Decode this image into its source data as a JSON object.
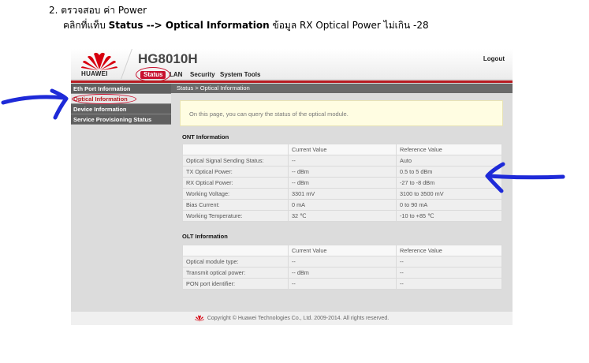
{
  "document": {
    "heading": "2. ตรวจสอบ ค่า Power",
    "instruction": {
      "prefix": "คลิกที่แท็บ ",
      "bold": "Status --> Optical Information",
      "suffix": " ข้อมูล RX Optical Power ไม่เกิน -28"
    }
  },
  "router": {
    "brand": "HUAWEI",
    "model": "HG8010H",
    "logout_label": "Logout",
    "tabs": [
      {
        "label": "Status",
        "active": true
      },
      {
        "label": "LAN",
        "active": false
      },
      {
        "label": "Security",
        "active": false
      },
      {
        "label": "System Tools",
        "active": false
      }
    ],
    "sidebar": [
      {
        "label": "Eth Port Information",
        "sub": false
      },
      {
        "label": "Optical Information",
        "sub": true
      },
      {
        "label": "Device Information",
        "sub": false
      },
      {
        "label": "Service Provisioning Status",
        "sub": false
      }
    ],
    "breadcrumb": "Status > Optical Information",
    "notice": "On this page, you can query the status of the optical module.",
    "ont": {
      "title": "ONT Information",
      "headers": [
        "",
        "Current Value",
        "Reference Value"
      ],
      "rows": [
        [
          "Optical Signal Sending Status:",
          "--",
          "Auto"
        ],
        [
          "TX Optical Power:",
          "-- dBm",
          "0.5 to 5 dBm"
        ],
        [
          "RX Optical Power:",
          "-- dBm",
          "-27 to -8 dBm"
        ],
        [
          "Working Voltage:",
          "3301 mV",
          "3100 to 3500 mV"
        ],
        [
          "Bias Current:",
          "0 mA",
          "0 to 90 mA"
        ],
        [
          "Working Temperature:",
          "32 ℃",
          "-10 to +85 ℃"
        ]
      ]
    },
    "olt": {
      "title": "OLT Information",
      "headers": [
        "",
        "Current Value",
        "Reference Value"
      ],
      "rows": [
        [
          "Optical module type:",
          "--",
          "--"
        ],
        [
          "Transmit optical power:",
          "-- dBm",
          "--"
        ],
        [
          "PON port identifier:",
          "--",
          "--"
        ]
      ]
    },
    "footer": "Copyright © Huawei Technologies Co., Ltd. 2009-2014. All rights reserved.",
    "colors": {
      "brand_red": "#c8102e",
      "annotation_blue": "#1e2ad8"
    }
  }
}
